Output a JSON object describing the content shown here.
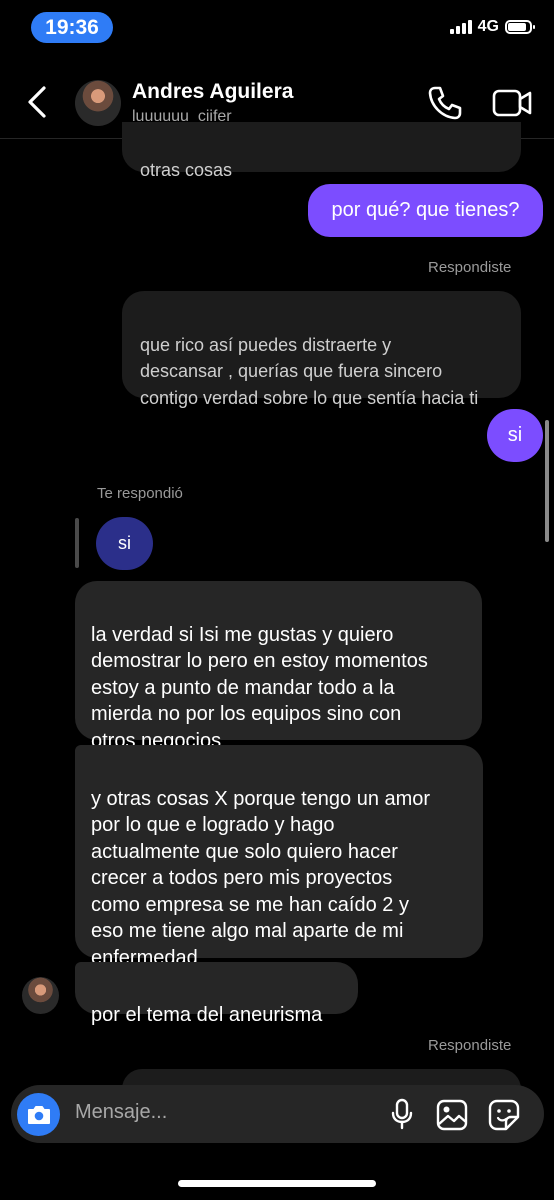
{
  "status_bar": {
    "time": "19:36",
    "network": "4G",
    "battery_level": 0.85
  },
  "header": {
    "name": "Andres Aguilera",
    "username": "luuuuuu_ciifer"
  },
  "messages": {
    "m0": "otras cosas",
    "m1": "por qué? que tienes?",
    "label_replied_1": "Respondiste",
    "m2_quoted": "que rico así puedes distraerte y\ndescansar , querías que fuera sincero\ncontigo verdad sobre lo que sentía hacia ti",
    "m3": "si",
    "label_te_respondio": "Te respondió",
    "m4_quoted": "si",
    "m5": "la verdad si Isi me gustas y quiero\ndemostrar lo pero en estoy momentos\nestoy a punto de mandar todo a la\nmierda no por los equipos sino con\notros negocios",
    "m6": "y otras cosas X porque tengo un amor\npor lo que e logrado y hago\nactualmente que solo quiero hacer\ncrecer a todos pero mis proyectos\ncomo empresa se me han caído 2 y\neso me tiene algo mal aparte de mi\nenfermedad",
    "m7": "por el tema del aneurisma",
    "label_replied_2": "Respondiste"
  },
  "composer": {
    "placeholder": "Mensaje..."
  },
  "colors": {
    "accent_blue": "#2f7cf6",
    "sent_bubble": "#7c4dff",
    "received_bubble": "#262626",
    "reply_quote": "#2b2f8a"
  },
  "icons": [
    "back-arrow-icon",
    "phone-icon",
    "video-camera-icon",
    "camera-icon",
    "microphone-icon",
    "gallery-icon",
    "sticker-icon"
  ]
}
